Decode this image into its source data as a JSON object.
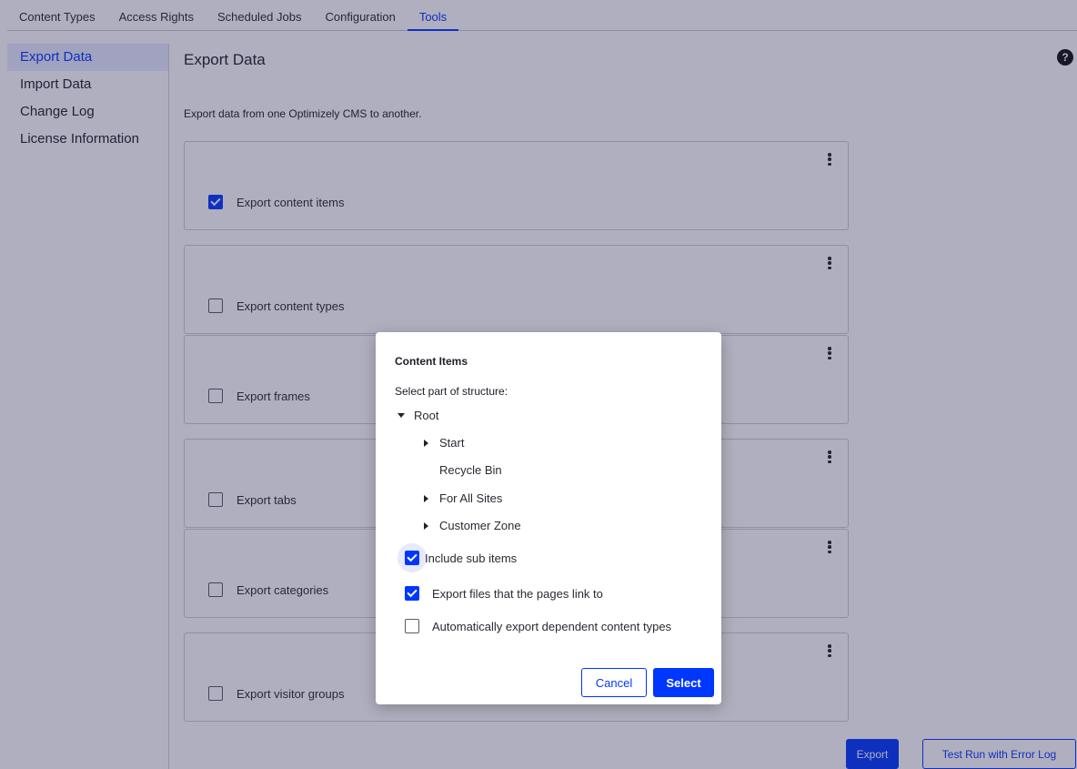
{
  "top_nav": {
    "items": [
      {
        "label": "Content Types"
      },
      {
        "label": "Access Rights"
      },
      {
        "label": "Scheduled Jobs"
      },
      {
        "label": "Configuration"
      },
      {
        "label": "Tools",
        "active": true
      }
    ]
  },
  "left_nav": {
    "items": [
      {
        "label": "Export Data",
        "active": true
      },
      {
        "label": "Import Data"
      },
      {
        "label": "Change Log"
      },
      {
        "label": "License Information"
      }
    ]
  },
  "main": {
    "title": "Export Data",
    "help_icon": "?",
    "description": "Export data from one Optimizely CMS to another.",
    "cards": [
      {
        "label": "Export content items",
        "checked": true
      },
      {
        "label": "Export content types",
        "checked": false
      },
      {
        "label": "Export frames",
        "checked": false
      },
      {
        "label": "Export tabs",
        "checked": false
      },
      {
        "label": "Export categories",
        "checked": false
      },
      {
        "label": "Export visitor groups",
        "checked": false
      }
    ],
    "export_button": "Export",
    "test_run_button": "Test Run with Error Log"
  },
  "dialog": {
    "title": "Content Items",
    "subtitle": "Select part of structure:",
    "tree": {
      "root": "Root",
      "children": [
        {
          "label": "Start",
          "expandable": true
        },
        {
          "label": "Recycle Bin",
          "expandable": false
        },
        {
          "label": "For All Sites",
          "expandable": true
        },
        {
          "label": "Customer Zone",
          "expandable": true
        }
      ]
    },
    "options": [
      {
        "label": "Include sub items",
        "checked": true
      },
      {
        "label": "Export files that the pages link to",
        "checked": true
      },
      {
        "label": "Automatically export dependent content types",
        "checked": false
      }
    ],
    "cancel_button": "Cancel",
    "select_button": "Select"
  },
  "colors": {
    "accent": "#0037ff",
    "overlay": "#262652"
  }
}
